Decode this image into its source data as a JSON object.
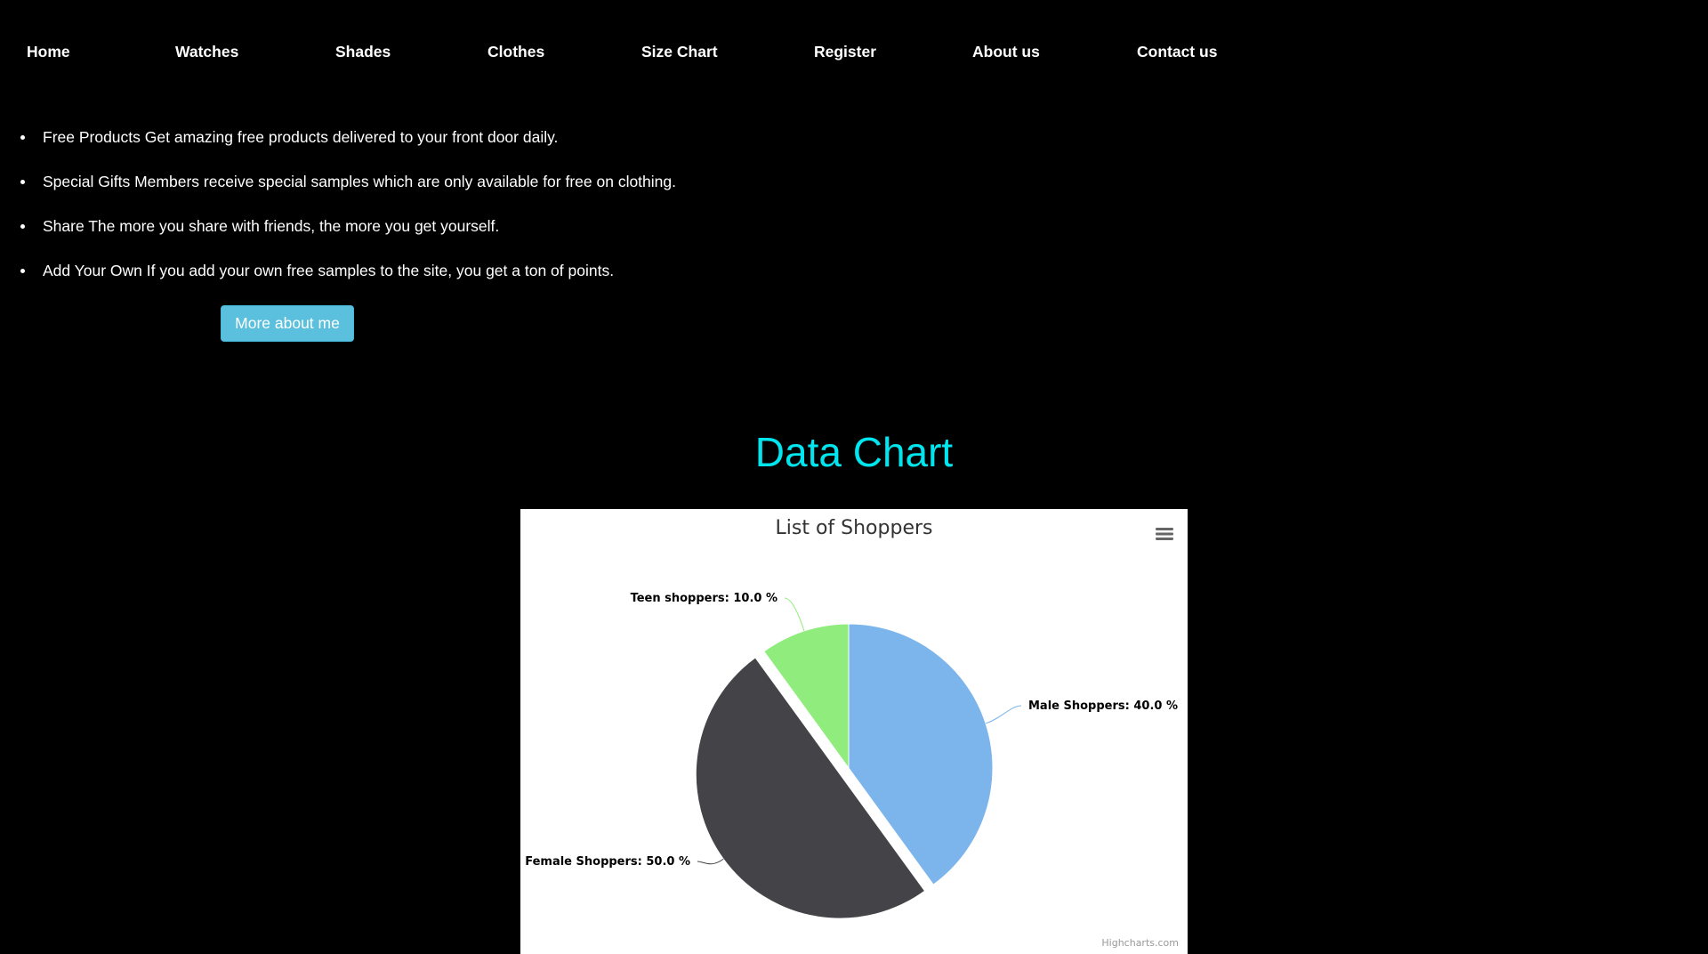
{
  "nav": {
    "items": [
      {
        "label": "Home"
      },
      {
        "label": "Watches"
      },
      {
        "label": "Shades"
      },
      {
        "label": "Clothes"
      },
      {
        "label": "Size Chart"
      },
      {
        "label": "Register"
      },
      {
        "label": "About us"
      },
      {
        "label": "Contact us"
      }
    ]
  },
  "features": [
    {
      "text": "Free Products Get amazing free products delivered to your front door daily."
    },
    {
      "text": "Special Gifts Members receive special samples which are only available for free on clothing."
    },
    {
      "text": "Share The more you share with friends, the more you get yourself."
    },
    {
      "text": "Add Your Own If you add your own free samples to the site, you get a ton of points."
    }
  ],
  "more_button": {
    "label": "More about me"
  },
  "section_title": "Data Chart",
  "chart_menu_icon": "hamburger-menu-icon",
  "chart_credits": "Highcharts.com",
  "colors": {
    "page_background": "#000000",
    "nav_text": "#ffffff",
    "button_bg": "#5bc0de",
    "section_title": "#00e5ee",
    "chart_background": "#ffffff"
  },
  "chart_data": {
    "type": "pie",
    "title": "List of Shoppers",
    "label_format": "{name}: {value} %",
    "slices": [
      {
        "name": "Male Shoppers",
        "value": 40.0,
        "color": "#7cb5ec",
        "sliced": false
      },
      {
        "name": "Female Shoppers",
        "value": 50.0,
        "color": "#434348",
        "sliced": true
      },
      {
        "name": "Teen shoppers",
        "value": 10.0,
        "color": "#90ed7d",
        "sliced": false
      }
    ]
  }
}
